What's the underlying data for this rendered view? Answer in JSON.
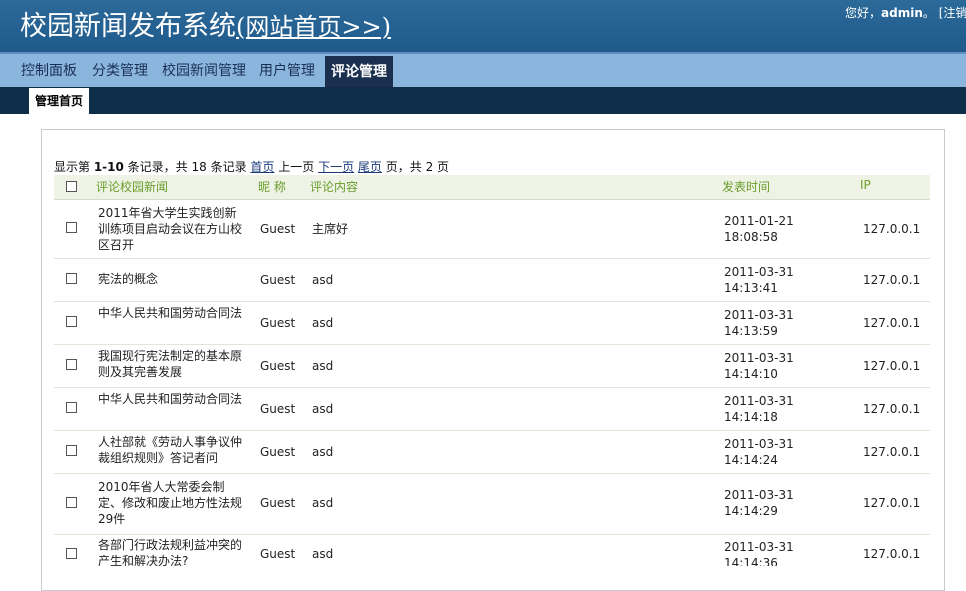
{
  "header": {
    "title": "校园新闻发布系统",
    "home_link": "(网站首页>>)",
    "greeting": "您好，",
    "username": "admin",
    "greeting_suffix": "。",
    "register_link": "[注销"
  },
  "nav": {
    "items": [
      "控制面板",
      "分类管理",
      "校园新闻管理",
      "用户管理",
      "评论管理"
    ],
    "active": "评论管理"
  },
  "subnav": {
    "home": "管理首页"
  },
  "pager": {
    "prefix": "显示第 ",
    "range": "1-10",
    "mid": " 条记录，共 18 条记录 ",
    "first": "首页",
    "prev": "上一页",
    "next": "下一页",
    "last": "尾页",
    "suffix": " 页，共 2 页"
  },
  "table": {
    "columns": {
      "news": "评论校园新闻",
      "nick": "昵 称",
      "content": "评论内容",
      "time": "发表时间",
      "ip": "IP"
    },
    "rows": [
      {
        "news": "2011年省大学生实践创新训练项目启动会议在方山校区召开",
        "nick": "Guest",
        "content": "主席好",
        "date": "2011-01-21",
        "clock": "18:08:58",
        "ip": "127.0.0.1"
      },
      {
        "news": "宪法的概念",
        "nick": "Guest",
        "content": "asd",
        "date": "2011-03-31",
        "clock": "14:13:41",
        "ip": "127.0.0.1"
      },
      {
        "news": "中华人民共和国劳动合同法",
        "nick": "Guest",
        "content": "asd",
        "date": "2011-03-31",
        "clock": "14:13:59",
        "ip": "127.0.0.1"
      },
      {
        "news": "我国现行宪法制定的基本原则及其完善发展",
        "nick": "Guest",
        "content": "asd",
        "date": "2011-03-31",
        "clock": "14:14:10",
        "ip": "127.0.0.1"
      },
      {
        "news": "中华人民共和国劳动合同法",
        "nick": "Guest",
        "content": "asd",
        "date": "2011-03-31",
        "clock": "14:14:18",
        "ip": "127.0.0.1"
      },
      {
        "news": "人社部就《劳动人事争议仲裁组织规则》答记者问",
        "nick": "Guest",
        "content": "asd",
        "date": "2011-03-31",
        "clock": "14:14:24",
        "ip": "127.0.0.1"
      },
      {
        "news": "2010年省人大常委会制定、修改和废止地方性法规29件",
        "nick": "Guest",
        "content": "asd",
        "date": "2011-03-31",
        "clock": "14:14:29",
        "ip": "127.0.0.1"
      },
      {
        "news": "各部门行政法规利益冲突的产生和解决办法?",
        "nick": "Guest",
        "content": "asd",
        "date": "2011-03-31",
        "clock": "14:14:36",
        "ip": "127.0.0.1"
      }
    ]
  }
}
